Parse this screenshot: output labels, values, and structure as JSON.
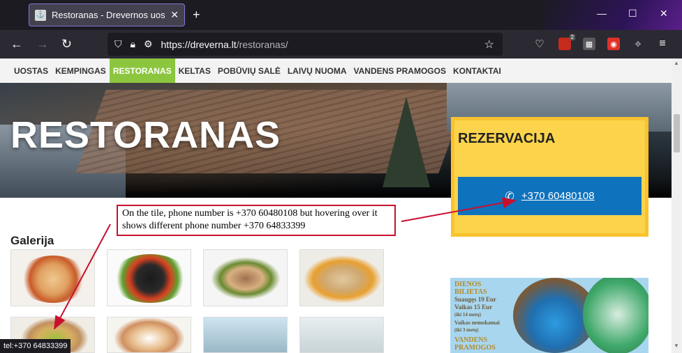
{
  "browser": {
    "tab_title": "Restoranas - Drevernos uostas",
    "tab_close": "✕",
    "new_tab": "+",
    "url_host": "https://dreverna.lt",
    "url_path": "/restoranas/",
    "badge_count": "2",
    "window_controls": {
      "minimize": "—",
      "maximize": "☐",
      "close": "✕"
    }
  },
  "menu": {
    "items": [
      {
        "label": "UOSTAS"
      },
      {
        "label": "KEMPINGAS"
      },
      {
        "label": "RESTORANAS"
      },
      {
        "label": "KELTAS"
      },
      {
        "label": "POBŪVIŲ SALĖ"
      },
      {
        "label": "LAIVŲ NUOMA"
      },
      {
        "label": "VANDENS PRAMOGOS"
      },
      {
        "label": "KONTAKTAI"
      }
    ],
    "active": "RESTORANAS",
    "active_color": "#8cc63f"
  },
  "hero": {
    "title": "RESTORANAS"
  },
  "reservation": {
    "heading": "REZERVACIJA",
    "phone": "+370 60480108",
    "button_color": "#0f72bd",
    "box_color": "#fbd44b"
  },
  "annotation": {
    "text": "On the tile, phone number is +370 60480108 but hovering over it shows different phone number +370 64833399",
    "border_color": "#c8102e"
  },
  "gallery": {
    "title": "Galerija",
    "images": [
      "food-photo-1",
      "food-photo-2",
      "food-photo-3",
      "food-photo-4",
      "food-photo-5",
      "food-photo-6",
      "food-photo-7",
      "food-photo-8"
    ]
  },
  "ad": {
    "line1": "DIENOS",
    "line2": "BILIETAS",
    "line3": "Suaugęs 19 Eur",
    "line4": "Vaikas   15 Eur",
    "line5": "(iki 14 metų)",
    "line6": "Vaikas   nemokamai",
    "line7": "(iki 3 metų)",
    "line8": "VANDENS",
    "line9": "PRAMOGOS"
  },
  "status_bar": {
    "text": "tel:+370 64833399"
  }
}
